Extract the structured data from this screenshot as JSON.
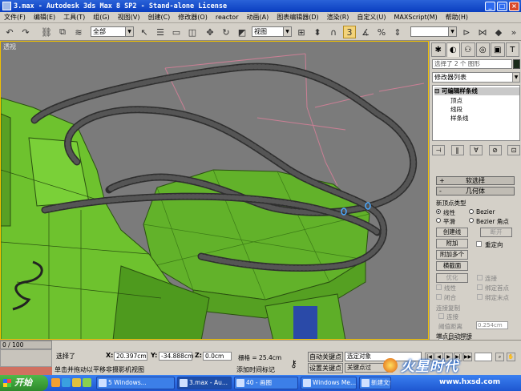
{
  "window": {
    "title": "3.max - Autodesk 3ds Max 8 SP2 - Stand-alone License",
    "min": "_",
    "max": "□",
    "close": "×"
  },
  "menu": [
    "文件(F)",
    "编辑(E)",
    "工具(T)",
    "组(G)",
    "视图(V)",
    "创建(C)",
    "修改器(O)",
    "reactor",
    "动画(A)",
    "图表编辑器(D)",
    "渲染(R)",
    "自定义(U)",
    "MAXScript(M)",
    "帮助(H)"
  ],
  "toolbar": {
    "selection_filter": "全部",
    "ref_coord": "视图"
  },
  "viewport": {
    "label": "透视"
  },
  "panel": {
    "selection_info": "选择了 2 个 图形",
    "modifier_list": "修改器列表",
    "stack_top": "可编辑样条线",
    "stack_items": [
      "顶点",
      "线段",
      "样条线"
    ],
    "rollout_soft": "软选择",
    "rollout_geom": "几何体",
    "new_vertex_type": "新顶点类型",
    "radio_linear": "线性",
    "radio_bezier": "Bezier",
    "radio_smooth": "平滑",
    "radio_bezier_corner": "Bezier 角点",
    "btn_create_line": "创建线",
    "btn_break": "断开",
    "btn_attach": "附加",
    "chk_reorient": "重定向",
    "btn_attach_mult": "附加多个",
    "btn_cross_section": "横截面",
    "grp_optimize": "优化",
    "btn_connect": "连接",
    "chk_linear": "线性",
    "chk_bind_first": "绑定首点",
    "chk_closed": "闭合",
    "chk_bind_last": "绑定末点",
    "grp_connect_copy": "连接复制",
    "chk_connect": "连接",
    "threshold_label": "阈值距离",
    "threshold_value": "0.254cm",
    "grp_end_weld": "端点自动焊接",
    "chk_auto_weld": "自动焊接"
  },
  "bottom": {
    "time_slider": "0 / 100",
    "selected": "选择了",
    "x_label": "X:",
    "x_value": "20.397cm",
    "y_label": "Y:",
    "y_value": "-34.888cm",
    "z_label": "Z:",
    "z_value": "0.0cm",
    "grid": "栅格 = 25.4cm",
    "prompt": "单击并拖动以平移非摄影机视图",
    "add_time_tag": "添加时间标记",
    "auto_key": "自动关键点",
    "set_key": "设置关键点",
    "selected_set": "选定对象",
    "key_filter": "关键点过"
  },
  "watermark": {
    "logo": "火星时代",
    "url": "www.hxsd.com"
  },
  "taskbar": {
    "start": "开始",
    "tasks": [
      "5 Windows...",
      "3.max - Au...",
      "40 - 画图",
      "Windows Me...",
      "新建文件夹"
    ]
  }
}
